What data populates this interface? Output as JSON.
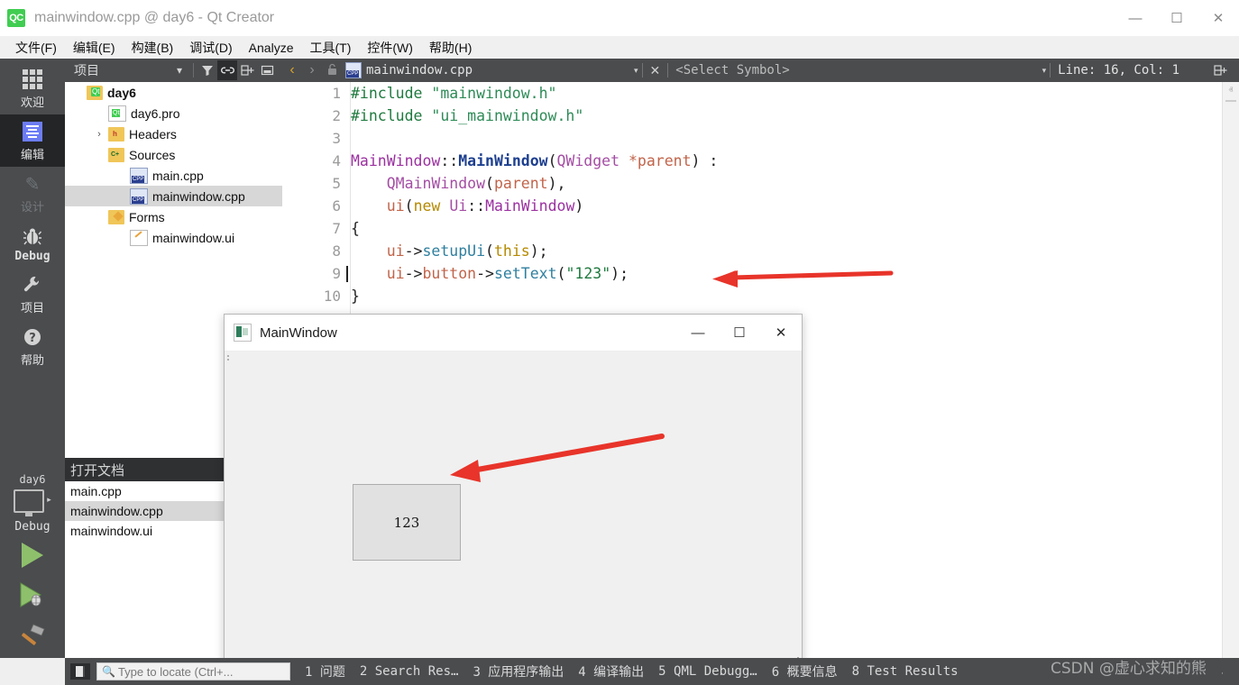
{
  "window": {
    "title": "mainwindow.cpp @ day6 - Qt Creator",
    "logo_text": "QC",
    "minimize": "—",
    "maximize": "☐",
    "close": "✕"
  },
  "menubar": {
    "items": [
      {
        "label": "文件(F)"
      },
      {
        "label": "编辑(E)"
      },
      {
        "label": "构建(B)"
      },
      {
        "label": "调试(D)"
      },
      {
        "label": "Analyze"
      },
      {
        "label": "工具(T)"
      },
      {
        "label": "控件(W)"
      },
      {
        "label": "帮助(H)"
      }
    ]
  },
  "modebar": {
    "items": [
      {
        "label": "欢迎",
        "icon": "grid-icon",
        "active": false
      },
      {
        "label": "编辑",
        "icon": "edit-lines-icon",
        "active": true
      },
      {
        "label": "设计",
        "icon": "pencil-icon",
        "active": false,
        "disabled": true
      },
      {
        "label": "Debug",
        "icon": "bug-icon",
        "active": false
      },
      {
        "label": "项目",
        "icon": "wrench-icon",
        "active": false
      },
      {
        "label": "帮助",
        "icon": "question-icon",
        "active": false
      }
    ],
    "kit_name": "day6",
    "kit_build": "Debug",
    "run_icon": "play-icon",
    "debug_icon": "play-debug-icon",
    "build_icon": "hammer-icon"
  },
  "left_toolbar": {
    "combo_label": "项目",
    "caret": "▾",
    "filter_icon": "filter-icon",
    "link_icon": "link-icon",
    "split_icon": "split-pane-icon",
    "close_pane_icon": "close-pane-icon"
  },
  "project_tree": {
    "rows": [
      {
        "label": "day6",
        "indent": 0,
        "twisty": "ⱟ",
        "icon": "folder-qt",
        "bold": true,
        "selected": false
      },
      {
        "label": "day6.pro",
        "indent": 1,
        "twisty": "",
        "icon": "file-pro",
        "bold": false,
        "selected": false
      },
      {
        "label": "Headers",
        "indent": 1,
        "twisty": "›",
        "icon": "folder-h",
        "bold": false,
        "selected": false
      },
      {
        "label": "Sources",
        "indent": 1,
        "twisty": "ⱟ",
        "icon": "folder-c",
        "bold": false,
        "selected": false
      },
      {
        "label": "main.cpp",
        "indent": 2,
        "twisty": "",
        "icon": "file-cpp",
        "bold": false,
        "selected": false
      },
      {
        "label": "mainwindow.cpp",
        "indent": 2,
        "twisty": "",
        "icon": "file-cpp",
        "bold": false,
        "selected": true
      },
      {
        "label": "Forms",
        "indent": 1,
        "twisty": "ⱟ",
        "icon": "folder-plain",
        "bold": false,
        "selected": false
      },
      {
        "label": "mainwindow.ui",
        "indent": 2,
        "twisty": "",
        "icon": "file-ui",
        "bold": false,
        "selected": false
      }
    ]
  },
  "open_documents": {
    "header": "打开文档",
    "items": [
      {
        "label": "main.cpp",
        "selected": false
      },
      {
        "label": "mainwindow.cpp",
        "selected": true
      },
      {
        "label": "mainwindow.ui",
        "selected": false
      }
    ]
  },
  "editor_toolbar": {
    "back": "‹",
    "forward": "›",
    "lock": "🔓",
    "file_name": "mainwindow.cpp",
    "file_caret": "▾",
    "close_file": "✕",
    "symbol_selector": "<Select Symbol>",
    "symbol_caret": "▾",
    "cursor_position": "Line: 16, Col: 1",
    "split_icon": "split-pane-icon"
  },
  "editor": {
    "lines": [
      {
        "num": "1",
        "fold": "",
        "caret": false,
        "tokens": [
          {
            "t": "#include ",
            "c": "tk-pre"
          },
          {
            "t": "\"mainwindow.h\"",
            "c": "tk-str"
          }
        ]
      },
      {
        "num": "2",
        "fold": "",
        "caret": false,
        "tokens": [
          {
            "t": "#include ",
            "c": "tk-pre"
          },
          {
            "t": "\"ui_mainwindow.h\"",
            "c": "tk-str"
          }
        ]
      },
      {
        "num": "3",
        "fold": "",
        "caret": false,
        "tokens": []
      },
      {
        "num": "4",
        "fold": "",
        "caret": false,
        "tokens": [
          {
            "t": "MainWindow",
            "c": "tk-cls"
          },
          {
            "t": "::",
            "c": "tk-op"
          },
          {
            "t": "MainWindow",
            "c": "tk-cls-b"
          },
          {
            "t": "(",
            "c": "tk-op"
          },
          {
            "t": "QWidget",
            "c": "tk-typ"
          },
          {
            "t": " *parent",
            "c": "tk-var"
          },
          {
            "t": ") :",
            "c": "tk-op"
          }
        ]
      },
      {
        "num": "5",
        "fold": "",
        "caret": false,
        "tokens": [
          {
            "t": "    ",
            "c": "tk-op"
          },
          {
            "t": "QMainWindow",
            "c": "tk-typ"
          },
          {
            "t": "(",
            "c": "tk-op"
          },
          {
            "t": "parent",
            "c": "tk-var"
          },
          {
            "t": "),",
            "c": "tk-op"
          }
        ]
      },
      {
        "num": "6",
        "fold": "ⱟ",
        "caret": false,
        "tokens": [
          {
            "t": "    ",
            "c": "tk-op"
          },
          {
            "t": "ui",
            "c": "tk-var"
          },
          {
            "t": "(",
            "c": "tk-op"
          },
          {
            "t": "new",
            "c": "tk-kw"
          },
          {
            "t": " ",
            "c": "tk-op"
          },
          {
            "t": "Ui",
            "c": "tk-typ"
          },
          {
            "t": "::",
            "c": "tk-op"
          },
          {
            "t": "MainWindow",
            "c": "tk-cls"
          },
          {
            "t": ")",
            "c": "tk-op"
          }
        ]
      },
      {
        "num": "7",
        "fold": "",
        "caret": false,
        "tokens": [
          {
            "t": "{",
            "c": "tk-op"
          }
        ]
      },
      {
        "num": "8",
        "fold": "",
        "caret": false,
        "tokens": [
          {
            "t": "    ",
            "c": "tk-op"
          },
          {
            "t": "ui",
            "c": "tk-var"
          },
          {
            "t": "->",
            "c": "tk-op"
          },
          {
            "t": "setupUi",
            "c": "tk-fn"
          },
          {
            "t": "(",
            "c": "tk-op"
          },
          {
            "t": "this",
            "c": "tk-this"
          },
          {
            "t": ");",
            "c": "tk-op"
          }
        ]
      },
      {
        "num": "9",
        "fold": "",
        "caret": true,
        "tokens": [
          {
            "t": "    ",
            "c": "tk-op"
          },
          {
            "t": "ui",
            "c": "tk-var"
          },
          {
            "t": "->",
            "c": "tk-op"
          },
          {
            "t": "button",
            "c": "tk-var"
          },
          {
            "t": "->",
            "c": "tk-op"
          },
          {
            "t": "setText",
            "c": "tk-fn"
          },
          {
            "t": "(",
            "c": "tk-op"
          },
          {
            "t": "\"123\"",
            "c": "tk-num"
          },
          {
            "t": ");",
            "c": "tk-op"
          }
        ]
      },
      {
        "num": "10",
        "fold": "",
        "caret": false,
        "tokens": [
          {
            "t": "}",
            "c": "tk-op"
          }
        ]
      }
    ],
    "scroll_up": "ⱏ",
    "scroll_down": "ⱟ"
  },
  "mainwindow_dialog": {
    "title": "MainWindow",
    "minimize": "—",
    "maximize": "☐",
    "close": "✕",
    "button_label": "123"
  },
  "statusbar": {
    "locator_placeholder": "Type to locate (Ctrl+...",
    "search_icon": "magnifier-icon",
    "sidebar_toggle_icon": "toggle-sidebar-icon",
    "items": [
      "1 问题",
      "2 Search Res…",
      "3 应用程序输出",
      "4 编译输出",
      "5 QML Debugg…",
      "6 概要信息",
      "8 Test Results"
    ],
    "expand_caret": "⌄"
  },
  "watermark": "CSDN @虚心求知的熊",
  "colors": {
    "accent_green": "#41cd52",
    "mode_bar": "#4a4c4e",
    "mode_active": "#232527",
    "selection": "#d7d7d7",
    "arrow_red": "#e8342a"
  }
}
